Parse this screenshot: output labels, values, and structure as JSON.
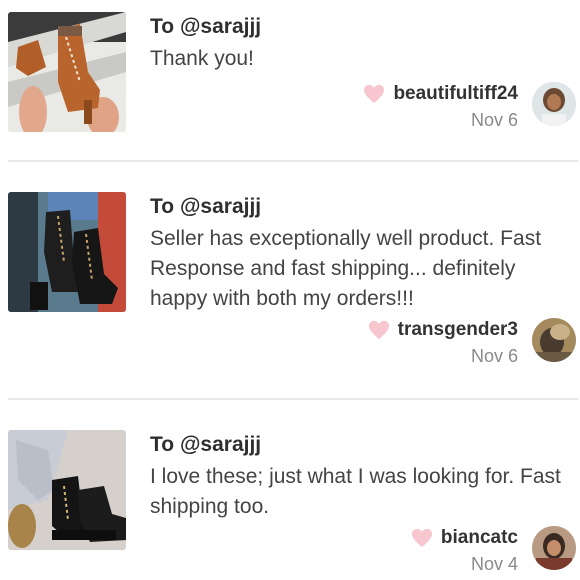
{
  "colors": {
    "heart": "#f7c6cf",
    "text": "#444444",
    "muted": "#8a8a8a",
    "divider": "#e8e8e8"
  },
  "reviews": [
    {
      "to_prefix": "To ",
      "recipient": "@sarajjj",
      "message": "Thank you!",
      "username": "beautifultiff24",
      "date": "Nov 6",
      "product_image": "tan-lace-up-heeled-boots",
      "avatar_icon": "user-avatar"
    },
    {
      "to_prefix": "To ",
      "recipient": "@sarajjj",
      "message": "Seller has exceptionally well product. Fast Response and fast shipping... definitely happy with both my orders!!!",
      "username": "transgender3",
      "date": "Nov 6",
      "product_image": "black-lace-up-heeled-boots",
      "avatar_icon": "user-avatar"
    },
    {
      "to_prefix": "To ",
      "recipient": "@sarajjj",
      "message": "I love these; just what I was looking for. Fast shipping too.",
      "username": "biancatc",
      "date": "Nov 4",
      "product_image": "black-platform-ankle-boots",
      "avatar_icon": "user-avatar"
    }
  ]
}
